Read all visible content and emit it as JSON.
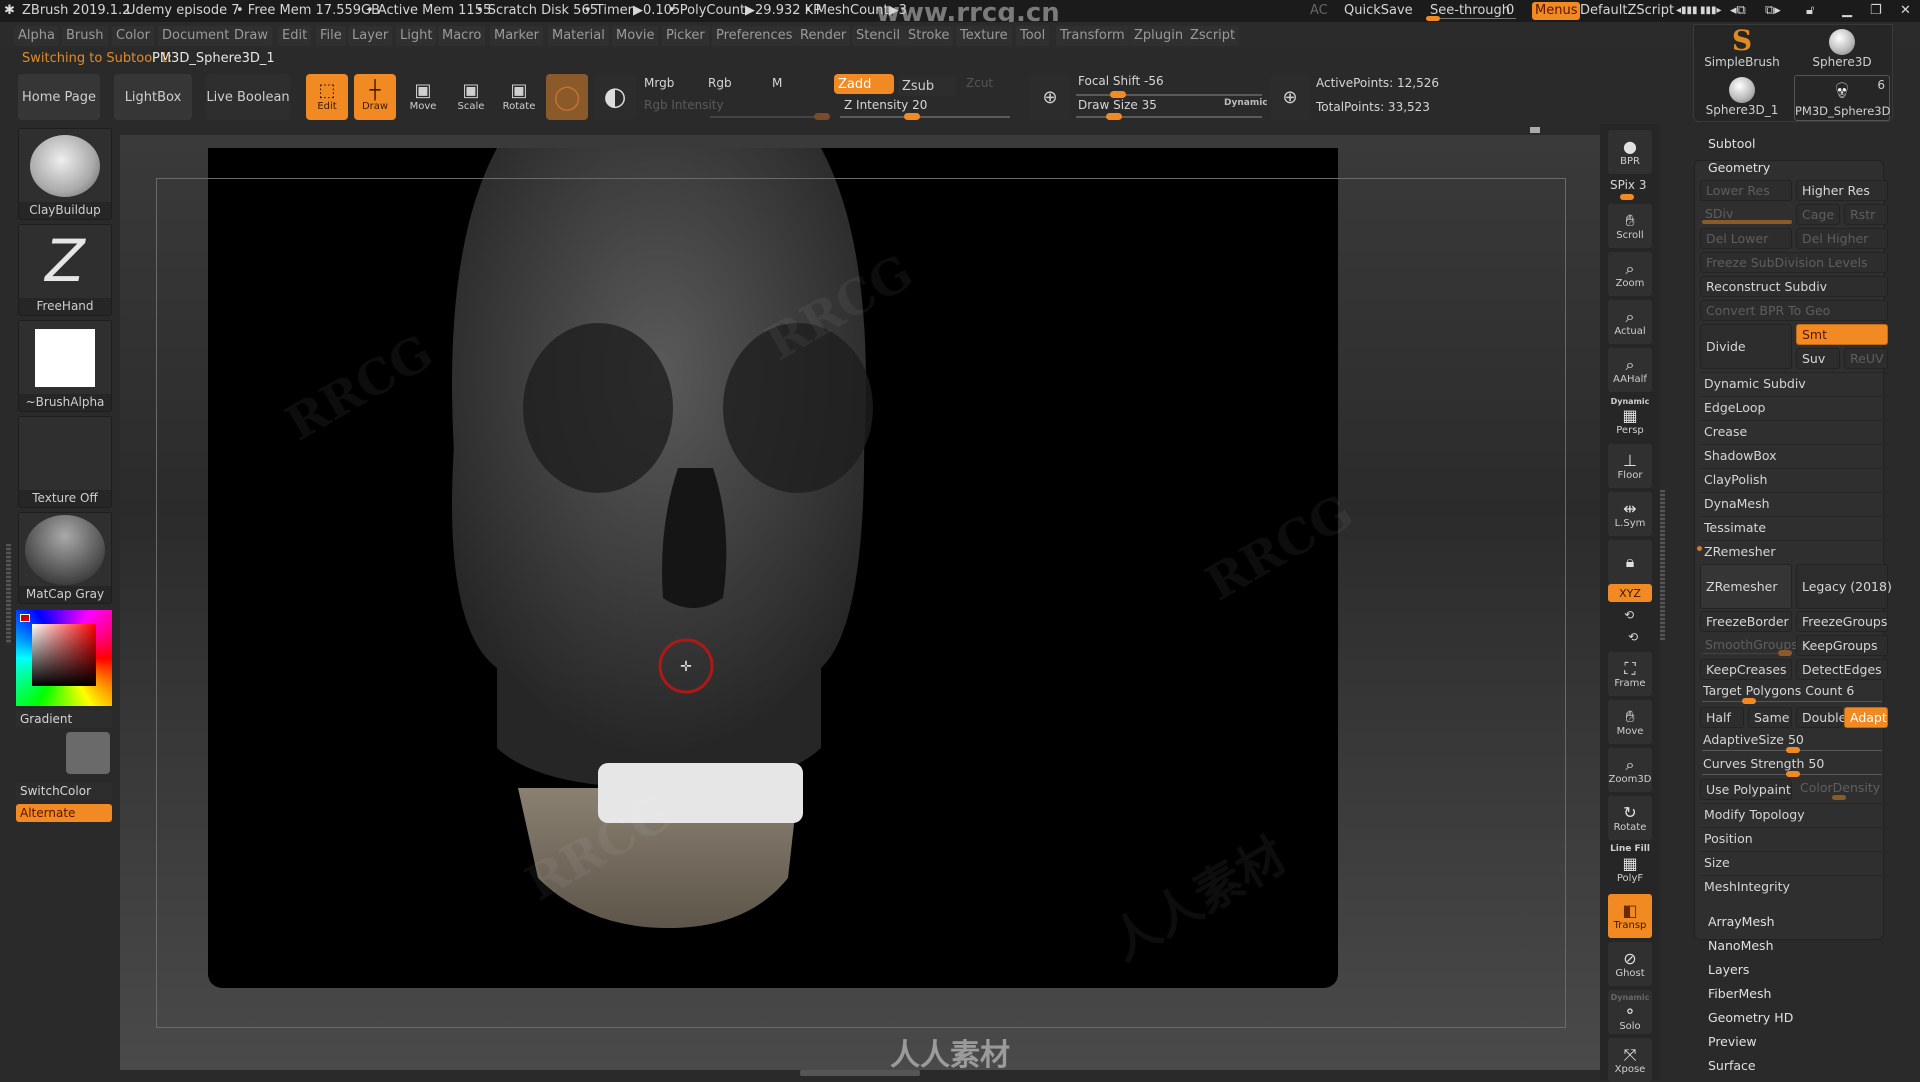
{
  "titlebar": {
    "app": "ZBrush 2019.1.2",
    "project": "Udemy episode 7",
    "free_mem": "• Free Mem 17.559GB",
    "active_mem": "• Active Mem 1155",
    "scratch": "• Scratch Disk 565",
    "timer": "• Timer▶0.105",
    "polycount": "• PolyCount▶29.932 KP",
    "meshcount": "• MeshCount▶3",
    "watermark_url": "www.rrcg.cn",
    "ac": "AC",
    "quicksave": "QuickSave",
    "see_through_label": "See-through",
    "see_through_value": "0",
    "see_through_fraction": 0.0,
    "menus": "Menus",
    "default_zscript": "DefaultZScript",
    "icons": [
      "scroll-left-icon",
      "scroll-right-icon",
      "dock-left-icon",
      "dock-right-icon",
      "lock-icon",
      "minimize-icon",
      "restore-icon",
      "close-icon"
    ]
  },
  "menubar": [
    "Alpha",
    "Brush",
    "Color",
    "Document",
    "Draw",
    "Edit",
    "File",
    "Layer",
    "Light",
    "Macro",
    "Marker",
    "Material",
    "Movie",
    "Picker",
    "Preferences",
    "Render",
    "Stencil",
    "Stroke",
    "Texture",
    "Tool",
    "Transform",
    "Zplugin",
    "Zscript"
  ],
  "notification": {
    "prefix": "Switching to Subtool 1:",
    "name": "PM3D_Sphere3D_1"
  },
  "toolbar": {
    "home_page": "Home Page",
    "lightbox": "LightBox",
    "live_boolean": "Live Boolean",
    "edit": "Edit",
    "draw": "Draw",
    "move": "Move",
    "scale": "Scale",
    "rotate": "Rotate",
    "mrgb": "Mrgb",
    "rgb": "Rgb",
    "m": "M",
    "rgb_intensity": "Rgb Intensity",
    "zadd": "Zadd",
    "zsub": "Zsub",
    "zcut": "Zcut",
    "z_intensity_label": "Z Intensity",
    "z_intensity": "20",
    "z_intensity_fraction": 0.2,
    "focal_shift_label": "Focal Shift",
    "focal_shift": "-56",
    "draw_size_label": "Draw Size",
    "draw_size": "35",
    "dynamic": "Dynamic",
    "active_points": "ActivePoints: 12,526",
    "total_points": "TotalPoints: 33,523"
  },
  "tool_palette": {
    "items": [
      {
        "label": "SimpleBrush"
      },
      {
        "label": "Sphere3D"
      },
      {
        "label": "Sphere3D_1"
      },
      {
        "label": "PM3D_Sphere3D",
        "count": "6"
      }
    ]
  },
  "left_panel": {
    "brush": "ClayBuildup",
    "stroke": "FreeHand",
    "alpha": "~BrushAlpha",
    "texture": "Texture Off",
    "material": "MatCap Gray",
    "gradient": "Gradient",
    "switch_color": "SwitchColor",
    "alternate": "Alternate"
  },
  "right_tools": {
    "bpr": "BPR",
    "spix": "SPix 3",
    "scroll": "Scroll",
    "zoom": "Zoom",
    "actual": "Actual",
    "aahalf": "AAHalf",
    "dynamic_persp_top": "Dynamic",
    "persp": "Persp",
    "floor": "Floor",
    "lsym": "L.Sym",
    "xyz": "XYZ",
    "frame": "Frame",
    "move": "Move",
    "zoom3d": "Zoom3D",
    "rotate": "Rotate",
    "linefill": "Line Fill",
    "polyf": "PolyF",
    "transp": "Transp",
    "ghost": "Ghost",
    "dynamic_solo_top": "Dynamic",
    "solo": "Solo",
    "xpose": "Xpose"
  },
  "right_panel": {
    "subtool": "Subtool",
    "geometry": "Geometry",
    "lower_res": "Lower Res",
    "higher_res": "Higher Res",
    "sdiv": "SDiv",
    "cage": "Cage",
    "rstr": "Rstr",
    "del_lower": "Del Lower",
    "del_higher": "Del Higher",
    "freeze_subdiv": "Freeze SubDivision Levels",
    "reconstruct_subdiv": "Reconstruct Subdiv",
    "convert_bpr": "Convert BPR To Geo",
    "divide": "Divide",
    "smt": "Smt",
    "suv": "Suv",
    "reuv": "ReUV",
    "sections": [
      "Dynamic Subdiv",
      "EdgeLoop",
      "Crease",
      "ShadowBox",
      "ClayPolish",
      "DynaMesh",
      "Tessimate"
    ],
    "zremesher_header": "ZRemesher",
    "zremesher_btn": "ZRemesher",
    "legacy": "Legacy (2018)",
    "freeze_border": "FreezeBorder",
    "freeze_groups": "FreezeGroups",
    "smooth_groups": "SmoothGroups",
    "keep_groups": "KeepGroups",
    "keep_creases": "KeepCreases",
    "detect_edges": "DetectEdges",
    "target_polys_label": "Target Polygons Count",
    "target_polys": "6",
    "half": "Half",
    "same": "Same",
    "double": "Double",
    "adapt": "Adapt",
    "adaptive_size_label": "AdaptiveSize",
    "adaptive_size": "50",
    "curves_strength_label": "Curves Strength",
    "curves_strength": "50",
    "use_polypaint": "Use Polypaint",
    "color_density": "ColorDensity",
    "sections2": [
      "Modify Topology",
      "Position",
      "Size",
      "MeshIntegrity"
    ],
    "more": [
      "ArrayMesh",
      "NanoMesh",
      "Layers",
      "FiberMesh",
      "Geometry HD",
      "Preview",
      "Surface"
    ]
  },
  "viewport": {
    "watermark_bottom": "人人素材",
    "watermark_rrcg": "RRCG",
    "watermark_cn": "人人素材"
  },
  "colors": {
    "accent": "#f28a24",
    "background": "#2a2a2a",
    "canvas": "#000000"
  }
}
